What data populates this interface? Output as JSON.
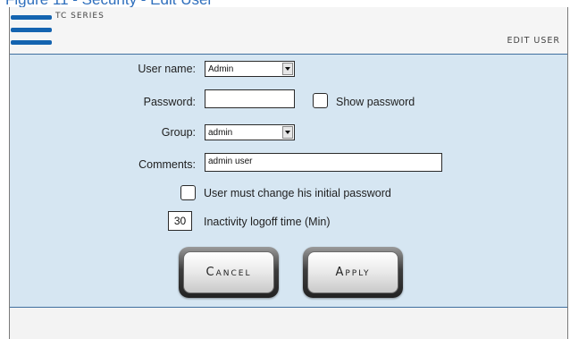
{
  "caption": "Figure 11 - Security - Edit User",
  "header": {
    "series": "TC SERIES",
    "screen_title": "EDIT USER",
    "menu_icon": "hamburger-menu-icon"
  },
  "form": {
    "user_name": {
      "label": "User name:",
      "value": "Admin"
    },
    "password": {
      "label": "Password:",
      "value": ""
    },
    "show_password": {
      "label": "Show password",
      "checked": false
    },
    "group": {
      "label": "Group:",
      "value": "admin"
    },
    "comments": {
      "label": "Comments:",
      "value": "admin user"
    },
    "must_change": {
      "label": "User must change his initial password",
      "checked": false
    },
    "inactivity": {
      "value": "30",
      "label": "Inactivity logoff time (Min)"
    }
  },
  "buttons": {
    "cancel": "Cancel",
    "apply": "Apply"
  },
  "colors": {
    "accent": "#1464b0",
    "panel": "#d6e6f2",
    "panel_border": "#3f6f9f"
  }
}
